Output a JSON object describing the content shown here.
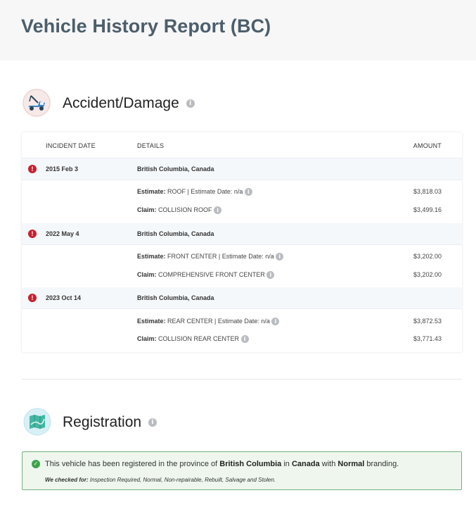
{
  "page": {
    "title": "Vehicle History Report (BC)"
  },
  "accident": {
    "title": "Accident/Damage",
    "columns": {
      "incident_date": "INCIDENT DATE",
      "details": "DETAILS",
      "amount": "AMOUNT"
    },
    "incidents": [
      {
        "date": "2015 Feb 3",
        "location": "British Columbia, Canada",
        "estimate": {
          "label": "Estimate:",
          "text": "ROOF | Estimate Date: n/a",
          "amount": "$3,818.03"
        },
        "claim": {
          "label": "Claim:",
          "text": "COLLISION ROOF",
          "amount": "$3,499.16"
        }
      },
      {
        "date": "2022 May 4",
        "location": "British Columbia, Canada",
        "estimate": {
          "label": "Estimate:",
          "text": "FRONT CENTER | Estimate Date: n/a",
          "amount": "$3,202.00"
        },
        "claim": {
          "label": "Claim:",
          "text": "COMPREHENSIVE FRONT CENTER",
          "amount": "$3,202.00"
        }
      },
      {
        "date": "2023 Oct 14",
        "location": "British Columbia, Canada",
        "estimate": {
          "label": "Estimate:",
          "text": "REAR CENTER | Estimate Date: n/a",
          "amount": "$3,872.53"
        },
        "claim": {
          "label": "Claim:",
          "text": "COLLISION REAR CENTER",
          "amount": "$3,771.43"
        }
      }
    ]
  },
  "registration": {
    "title": "Registration",
    "message": {
      "t1": "This vehicle has been registered in the province of ",
      "province": "British Columbia",
      "t2": " in ",
      "country": "Canada",
      "t3": " with ",
      "branding": "Normal",
      "t4": " branding."
    },
    "checked_label": "We checked for:",
    "checked_list": " Inspection Required, Normal, Non-repairable, Rebuilt, Salvage and Stolen."
  },
  "colors": {
    "alert": "#c8202e",
    "success": "#3ea34a",
    "header_text": "#4c5e6b"
  }
}
